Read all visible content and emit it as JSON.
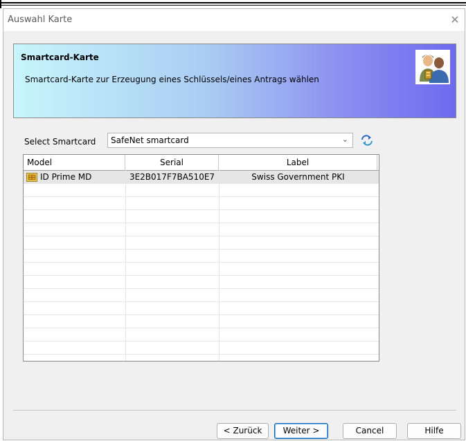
{
  "window": {
    "title": "Auswahl Karte",
    "close_glyph": "✕"
  },
  "banner": {
    "title": "Smartcard-Karte",
    "subtitle": "Smartcard-Karte zur Erzeugung eines Schlüssels/eines Antrags wählen",
    "icon": "users-key-icon"
  },
  "selector": {
    "label": "Select Smartcard",
    "value": "SafeNet smartcard",
    "refresh_icon": "refresh-icon"
  },
  "table": {
    "columns": [
      "Model",
      "Serial",
      "Label"
    ],
    "rows": [
      {
        "model": "ID Prime MD",
        "serial": "3E2B017F7BA510E7",
        "label": "Swiss Government PKI",
        "icon": "smartcard-chip-icon"
      }
    ]
  },
  "buttons": {
    "back": "< Zurück",
    "next": "Weiter >",
    "cancel": "Cancel",
    "help": "Hilfe"
  }
}
